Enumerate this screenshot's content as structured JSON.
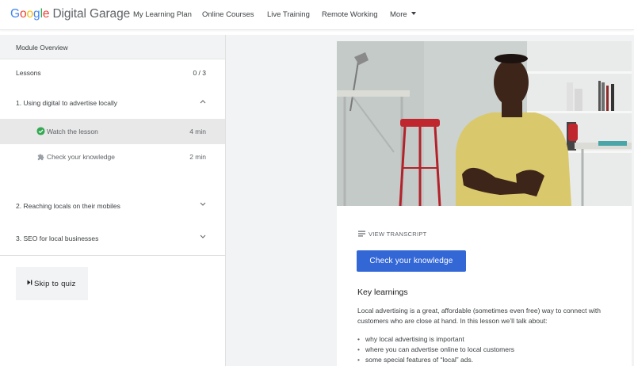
{
  "header": {
    "logo_letters": [
      "G",
      "o",
      "o",
      "g",
      "l",
      "e"
    ],
    "product": "Digital Garage",
    "nav": [
      "My Learning Plan",
      "Online Courses",
      "Live Training",
      "Remote Working",
      "More"
    ]
  },
  "sidebar": {
    "title": "Module Overview",
    "lessons_label": "Lessons",
    "progress": "0 / 3",
    "sections": [
      {
        "title": "1. Using digital to advertise locally",
        "expanded": true,
        "items": [
          {
            "label": "Watch the lesson",
            "duration": "4 min",
            "icon": "check-circle-icon",
            "active": true
          },
          {
            "label": "Check your knowledge",
            "duration": "2 min",
            "icon": "puzzle-icon",
            "active": false
          }
        ]
      },
      {
        "title": "2. Reaching locals on their mobiles",
        "expanded": false
      },
      {
        "title": "3. SEO for local businesses",
        "expanded": false
      }
    ],
    "skip_label": "Skip to quiz"
  },
  "main": {
    "transcript_label": "VIEW TRANSCRIPT",
    "check_button": "Check your knowledge",
    "key_learnings_title": "Key learnings",
    "key_learnings_text": "Local advertising is a great, affordable (sometimes even free) way to connect with customers who are close at hand. In this lesson we’ll talk about:",
    "key_learnings_list": [
      "why local advertising is important",
      "where you can advertise online to local customers",
      "some special features of “local” ads."
    ]
  },
  "colors": {
    "accent_button": "#3367d6",
    "check_green": "#34a853",
    "sidebar_active": "#e8e8e8",
    "main_bg": "#f1f3f4"
  }
}
